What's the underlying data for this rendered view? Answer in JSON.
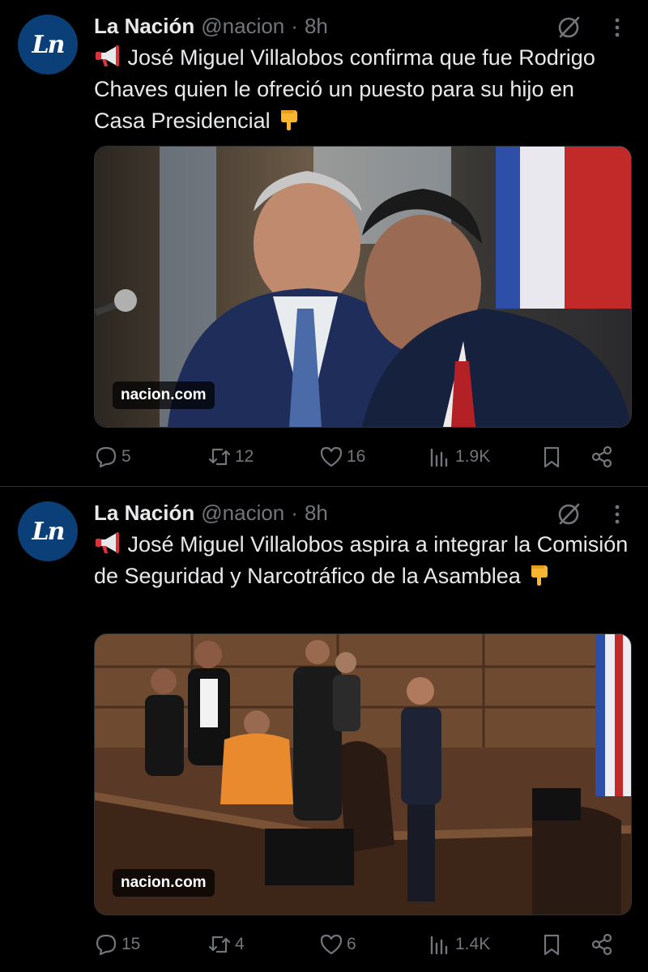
{
  "tweets": [
    {
      "author_name": "La Nación",
      "handle": "@nacion",
      "separator": "·",
      "time": "8h",
      "avatar_text": "Ln",
      "text": "José Miguel Villalobos confirma que fue Rodrigo Chaves quien le ofreció un puesto para su hijo en Casa Presidencial",
      "media_source": "nacion.com",
      "replies": "5",
      "retweets": "12",
      "likes": "16",
      "views": "1.9K"
    },
    {
      "author_name": "La Nación",
      "handle": "@nacion",
      "separator": "·",
      "time": "8h",
      "avatar_text": "Ln",
      "text": "José Miguel Villalobos aspira a integrar la Comisión de Seguridad y Narcotráfico de la Asamblea",
      "media_source": "nacion.com",
      "replies": "15",
      "retweets": "4",
      "likes": "6",
      "views": "1.4K"
    }
  ],
  "icons": {
    "megaphone": "megaphone-emoji",
    "pointing_down": "backhand-index-pointing-down-emoji",
    "grok": "grok-icon",
    "more": "more-icon",
    "reply": "reply-icon",
    "retweet": "retweet-icon",
    "like": "heart-icon",
    "views": "views-icon",
    "bookmark": "bookmark-icon",
    "share": "share-icon"
  },
  "colors": {
    "background": "#000000",
    "text": "#e7e9ea",
    "secondary": "#71767b",
    "avatar": "#0b3f77"
  }
}
